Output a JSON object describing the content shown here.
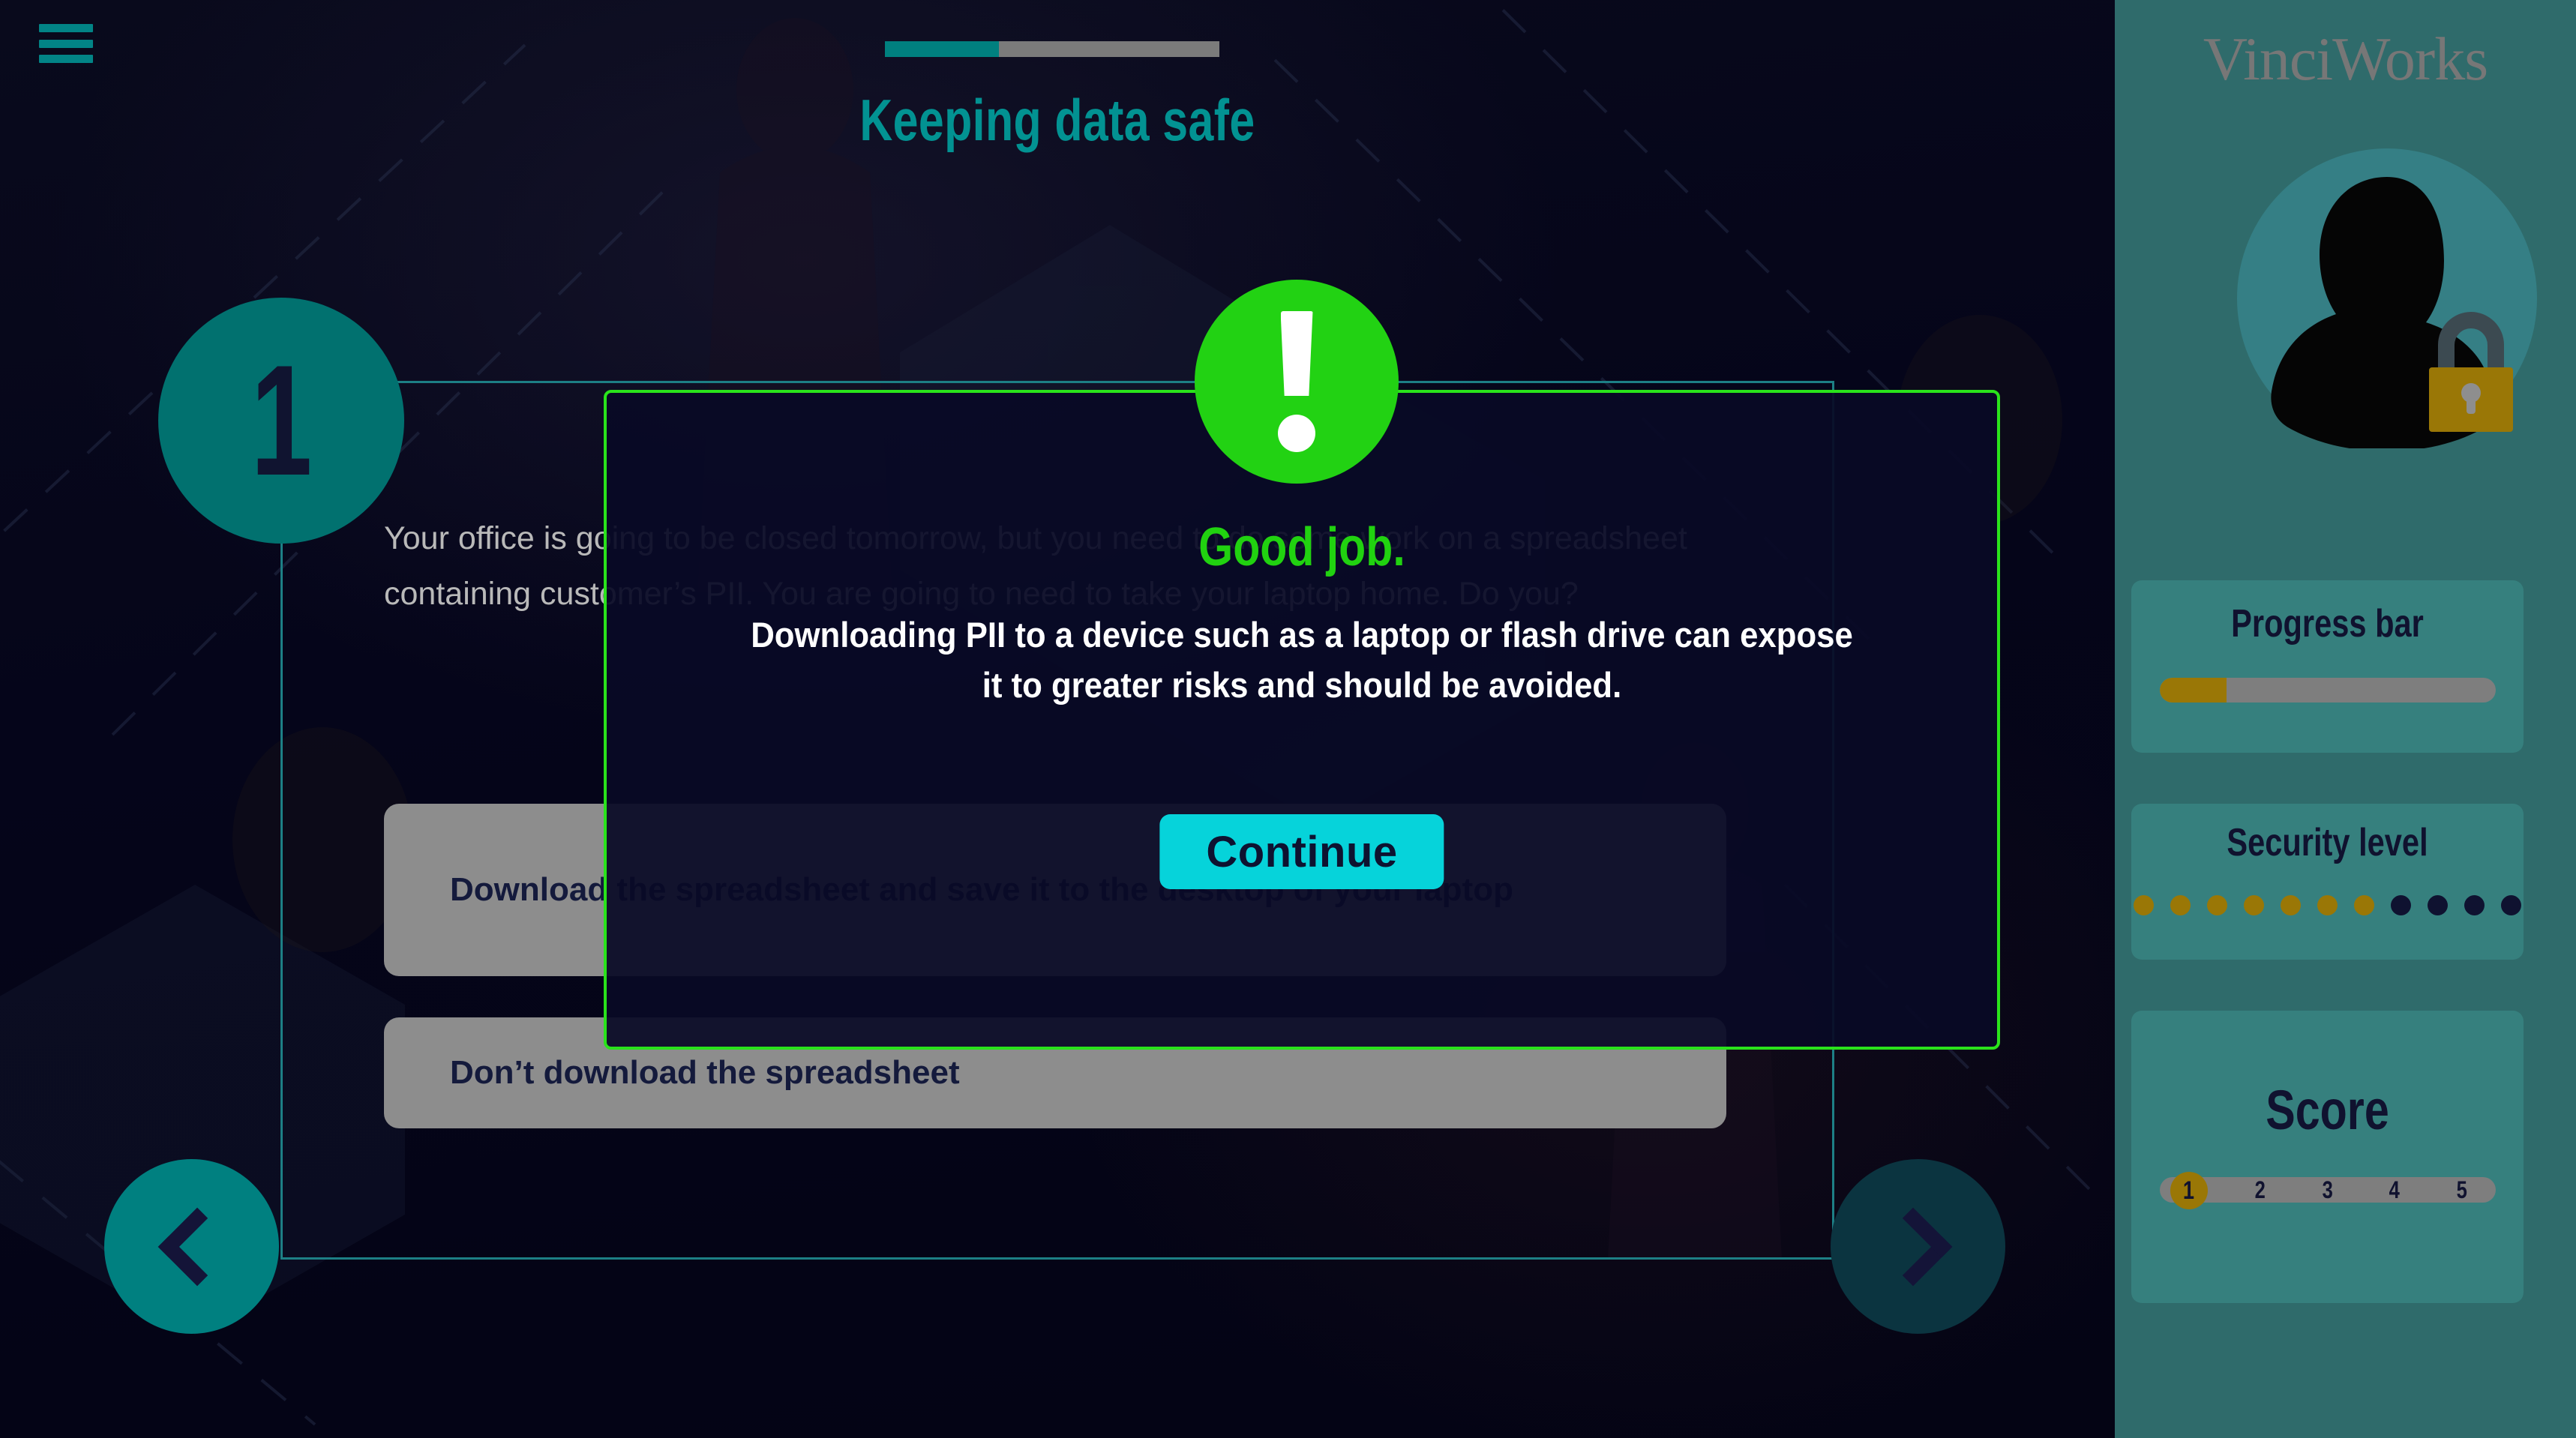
{
  "header": {
    "menu_icon": "hamburger-menu-icon",
    "title": "Keeping data safe",
    "progress_percent": 34
  },
  "lesson": {
    "step_number": "1",
    "question": "Your office is going to be closed tomorrow, but you need to do some work on a spreadsheet containing customer’s PII. You are going to need to take your laptop home. Do you?",
    "options": [
      {
        "label": "Download the spreadsheet and save it to the desktop of your laptop"
      },
      {
        "label": "Don’t download the spreadsheet"
      }
    ],
    "nav": {
      "prev_label": "chevron-left-icon",
      "next_label": "chevron-right-icon"
    }
  },
  "feedback_modal": {
    "status_icon": "exclamation-mark-icon",
    "heading": "Good job.",
    "body": "Downloading PII to a device such as a laptop or flash drive can expose it to greater risks and should be avoided.",
    "continue_label": "Continue"
  },
  "sidebar": {
    "brand": "VinciWorks",
    "avatar_icon": "user-silhouette-icon",
    "lock_icon": "padlock-icon",
    "progress": {
      "title": "Progress bar",
      "percent": 20
    },
    "security": {
      "title": "Security level",
      "filled": 7,
      "total": 11
    },
    "score": {
      "title": "Score",
      "current": "1",
      "ticks": [
        "1",
        "2",
        "3",
        "4",
        "5"
      ]
    }
  },
  "colors": {
    "teal_accent": "#00807f",
    "sidebar_bg": "#2f6b6b",
    "panel_bg": "#36807e",
    "gold": "#9a7706",
    "green_success": "#22d213",
    "cyan_button": "#06d3da",
    "navy_text": "#10122f",
    "option_bg": "#8d8d8d"
  }
}
